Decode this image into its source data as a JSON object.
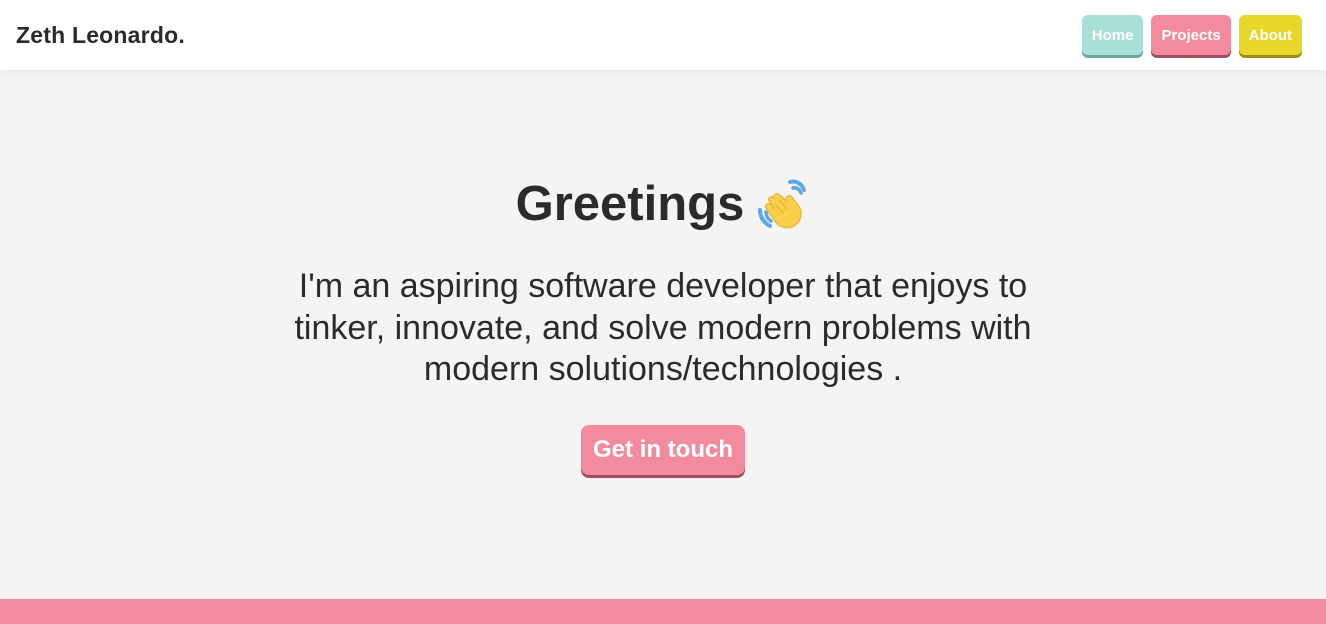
{
  "navbar": {
    "brand": "Zeth Leonardo.",
    "links": [
      {
        "label": "Home",
        "color": "#a8e0d5"
      },
      {
        "label": "Projects",
        "color": "#f38b9e"
      },
      {
        "label": "About",
        "color": "#e6d72a"
      }
    ]
  },
  "hero": {
    "title": "Greetings",
    "title_icon": "waving-hand-icon",
    "text": "I'm an aspiring software developer that enjoys to tinker, innovate, and solve modern problems with modern solutions/technologies .",
    "cta_label": "Get in touch"
  },
  "colors": {
    "background": "#f5f4f2",
    "accent_pink": "#f38b9e",
    "accent_teal": "#a8e0d5",
    "accent_yellow": "#e6d72a",
    "text": "#2b2b2b"
  }
}
